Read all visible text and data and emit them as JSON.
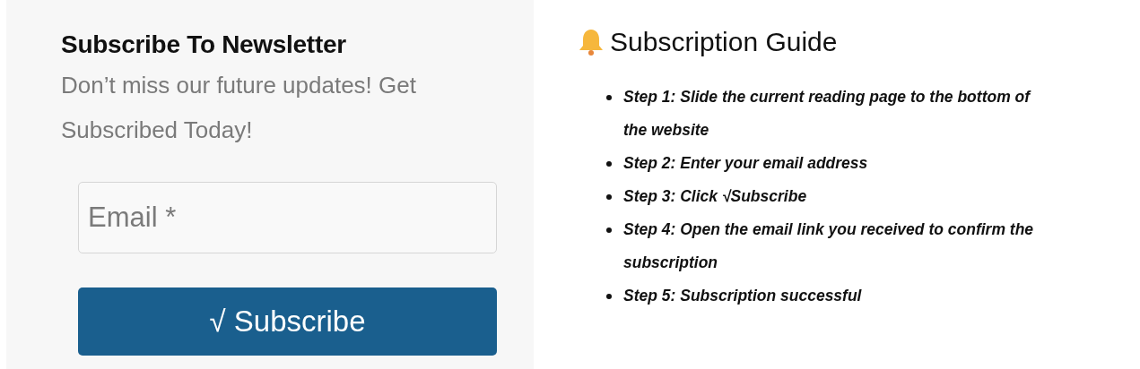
{
  "newsletter": {
    "title": "Subscribe To Newsletter",
    "subtitle": "Don’t miss our future updates! Get Subscribed Today!",
    "email_field": {
      "placeholder": "Email *"
    },
    "button": "√ Subscribe"
  },
  "guide": {
    "title": "Subscription Guide",
    "steps": [
      "Step 1: Slide the current reading page to the bottom of the website",
      "Step 2: Enter your email address",
      "Step 3: Click √Subscribe",
      "Step 4: Open the email link you received to confirm the subscription",
      "Step 5: Subscription successful"
    ]
  }
}
